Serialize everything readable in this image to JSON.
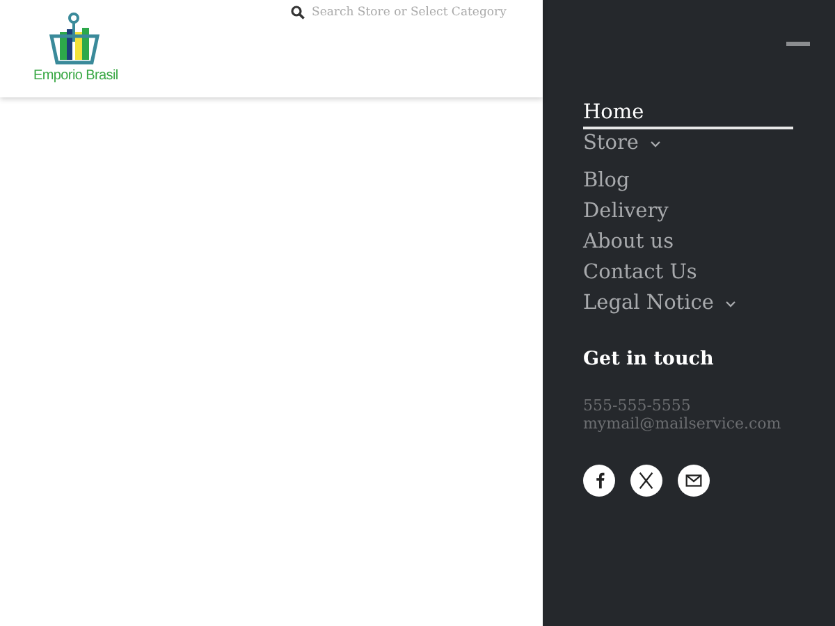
{
  "header": {
    "logo_text": "Emporio Brasil",
    "search": {
      "placeholder": "Search Store or Select Category"
    }
  },
  "menu": [
    {
      "label": "Home",
      "selected": true,
      "kind": "link"
    },
    {
      "label": "Store",
      "selected": false,
      "kind": "dropdown"
    },
    {
      "label": "Blog",
      "selected": false,
      "kind": "link"
    },
    {
      "label": "Delivery",
      "selected": false,
      "kind": "link"
    },
    {
      "label": "About us",
      "selected": false,
      "kind": "link"
    },
    {
      "label": "Contact Us",
      "selected": false,
      "kind": "link"
    },
    {
      "label": "Legal Notice",
      "selected": false,
      "kind": "dropdown"
    }
  ],
  "contact": {
    "heading": "Get in touch",
    "phone": "555-555-5555",
    "email": "mymail@mailservice.com"
  },
  "social": [
    {
      "kind": "facebook"
    },
    {
      "kind": "x"
    },
    {
      "kind": "mail"
    }
  ]
}
